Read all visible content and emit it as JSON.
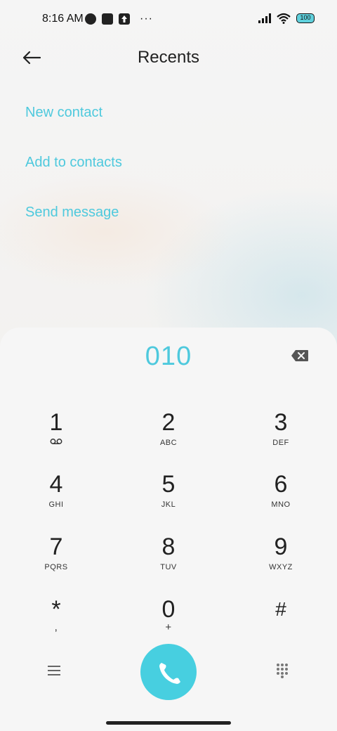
{
  "status": {
    "time": "8:16 AM",
    "battery": "100",
    "more": "···"
  },
  "header": {
    "title": "Recents"
  },
  "options": [
    "New contact",
    "Add to contacts",
    "Send message"
  ],
  "dialer": {
    "number": "010",
    "keys": [
      {
        "digit": "1",
        "letters": ""
      },
      {
        "digit": "2",
        "letters": "ABC"
      },
      {
        "digit": "3",
        "letters": "DEF"
      },
      {
        "digit": "4",
        "letters": "GHI"
      },
      {
        "digit": "5",
        "letters": "JKL"
      },
      {
        "digit": "6",
        "letters": "MNO"
      },
      {
        "digit": "7",
        "letters": "PQRS"
      },
      {
        "digit": "8",
        "letters": "TUV"
      },
      {
        "digit": "9",
        "letters": "WXYZ"
      },
      {
        "digit": "*",
        "letters": ","
      },
      {
        "digit": "0",
        "letters": "+"
      },
      {
        "digit": "#",
        "letters": ""
      }
    ]
  },
  "colors": {
    "accent": "#4ec9dd",
    "call": "#47cfe0"
  },
  "icons": {
    "back": "arrow-left-icon",
    "backspace": "backspace-icon",
    "voicemail": "voicemail-icon",
    "menu": "menu-icon",
    "call": "phone-icon",
    "keypad": "dialpad-icon"
  }
}
